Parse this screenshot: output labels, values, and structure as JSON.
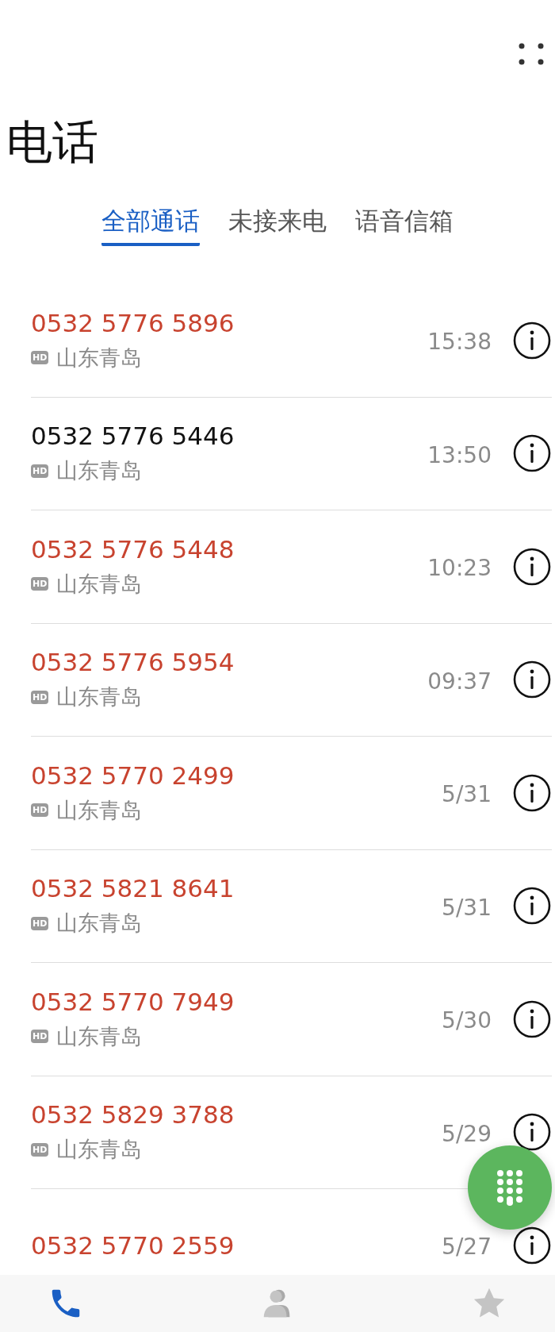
{
  "title": "电话",
  "tabs": [
    {
      "label": "全部通话",
      "selected": true
    },
    {
      "label": "未接来电",
      "selected": false
    },
    {
      "label": "语音信箱",
      "selected": false
    }
  ],
  "calls": [
    {
      "number": "0532 5776 5896",
      "missed": true,
      "badge": "HD",
      "location": "山东青岛",
      "time": "15:38"
    },
    {
      "number": "0532 5776 5446",
      "missed": false,
      "badge": "HD",
      "location": "山东青岛",
      "time": "13:50"
    },
    {
      "number": "0532 5776 5448",
      "missed": true,
      "badge": "HD",
      "location": "山东青岛",
      "time": "10:23"
    },
    {
      "number": "0532 5776 5954",
      "missed": true,
      "badge": "HD",
      "location": "山东青岛",
      "time": "09:37"
    },
    {
      "number": "0532 5770 2499",
      "missed": true,
      "badge": "HD",
      "location": "山东青岛",
      "time": "5/31"
    },
    {
      "number": "0532 5821 8641",
      "missed": true,
      "badge": "HD",
      "location": "山东青岛",
      "time": "5/31"
    },
    {
      "number": "0532 5770 7949",
      "missed": true,
      "badge": "HD",
      "location": "山东青岛",
      "time": "5/30"
    },
    {
      "number": "0532 5829 3788",
      "missed": true,
      "badge": "HD",
      "location": "山东青岛",
      "time": "5/29"
    },
    {
      "number": "0532 5770 2559",
      "missed": true,
      "time": "5/27"
    }
  ],
  "nav": [
    {
      "kind": "phone",
      "selected": true
    },
    {
      "kind": "contacts",
      "selected": false
    },
    {
      "kind": "favorites",
      "selected": false
    }
  ]
}
